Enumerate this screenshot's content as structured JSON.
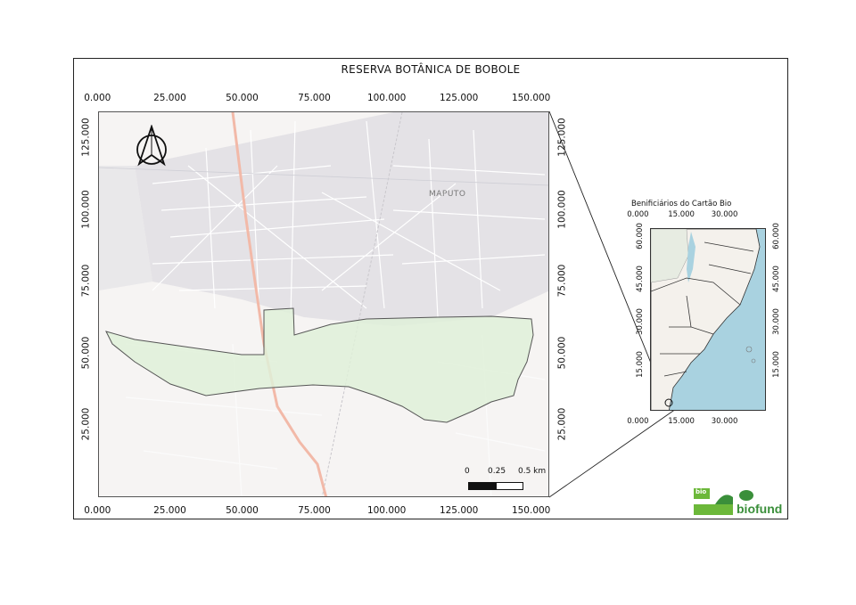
{
  "map": {
    "title": "RESERVA BOTÂNICA DE BOBOLE",
    "x_ticks": [
      "0.000",
      "25.000",
      "50.000",
      "75.000",
      "100.000",
      "125.000",
      "150.000"
    ],
    "y_ticks": [
      "125.000",
      "100.000",
      "75.000",
      "50.000",
      "25.000"
    ],
    "place_label": "MAPUTO",
    "scale_bar": {
      "labels": [
        "0",
        "0.25",
        "0.5 km"
      ]
    },
    "north_arrow_icon": "north-arrow-icon",
    "colors": {
      "reserve_fill": "#dff0d8",
      "reserve_stroke": "#555555",
      "road": "#f2b9a8",
      "base": "#f6f4f3"
    }
  },
  "inset": {
    "title": "Benificiários do Cartão Bio",
    "x_ticks": [
      "0.000",
      "15.000",
      "30.000"
    ],
    "y_ticks": [
      "60.000",
      "45.000",
      "30.000",
      "15.000"
    ],
    "colors": {
      "sea": "#a9d2e0",
      "land": "#f4f1ec"
    }
  },
  "logos": {
    "brand_text": "biofund",
    "secondary_text": "bio"
  }
}
